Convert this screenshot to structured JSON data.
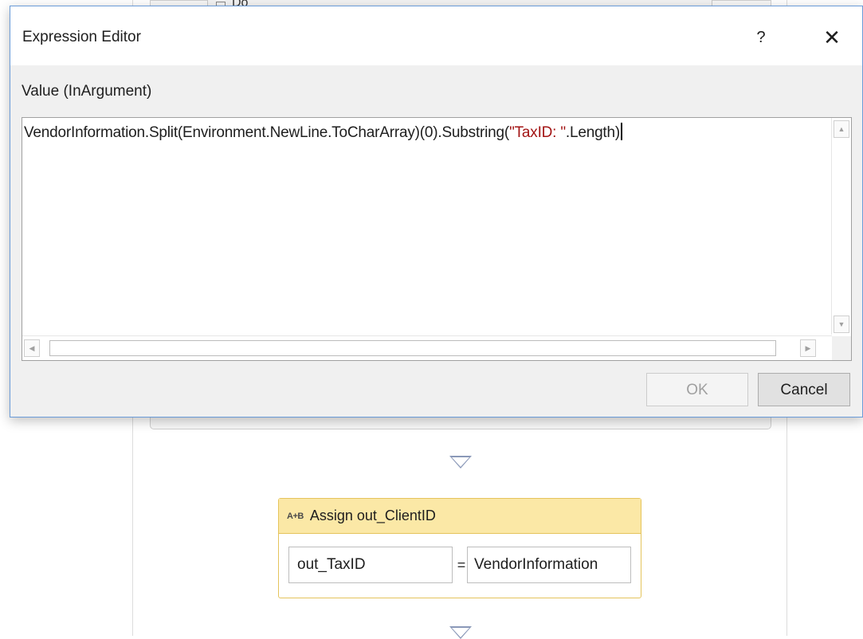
{
  "dialog": {
    "title": "Expression Editor",
    "help_label": "?",
    "close_label": "✕",
    "value_label": "Value (InArgument)",
    "expression": {
      "prefix": "VendorInformation.Split(Environment.NewLine.ToCharArray)(0).Substring(",
      "string_literal": "\"TaxID: \"",
      "suffix": ".Length)"
    },
    "ok_label": "OK",
    "cancel_label": "Cancel",
    "ok_enabled": false
  },
  "designer": {
    "do_label": "Do",
    "assign": {
      "icon_text": "A+B",
      "title": "Assign out_ClientID",
      "to_value": "out_TaxID",
      "equals": "=",
      "value_value": "VendorInformation"
    }
  },
  "colors": {
    "dialog_border": "#6a9bd8",
    "string_literal": "#a31515",
    "assign_header": "#fbe8a6",
    "assign_border": "#e5c45c",
    "connector": "#8a98b8"
  },
  "icons": {
    "help": "question-mark-icon",
    "close": "close-icon",
    "scroll_up": "triangle-up-icon",
    "scroll_down": "triangle-down-icon",
    "scroll_left": "triangle-left-icon",
    "scroll_right": "triangle-right-icon",
    "assign": "assign-icon",
    "connector": "connector-arrow-icon"
  }
}
